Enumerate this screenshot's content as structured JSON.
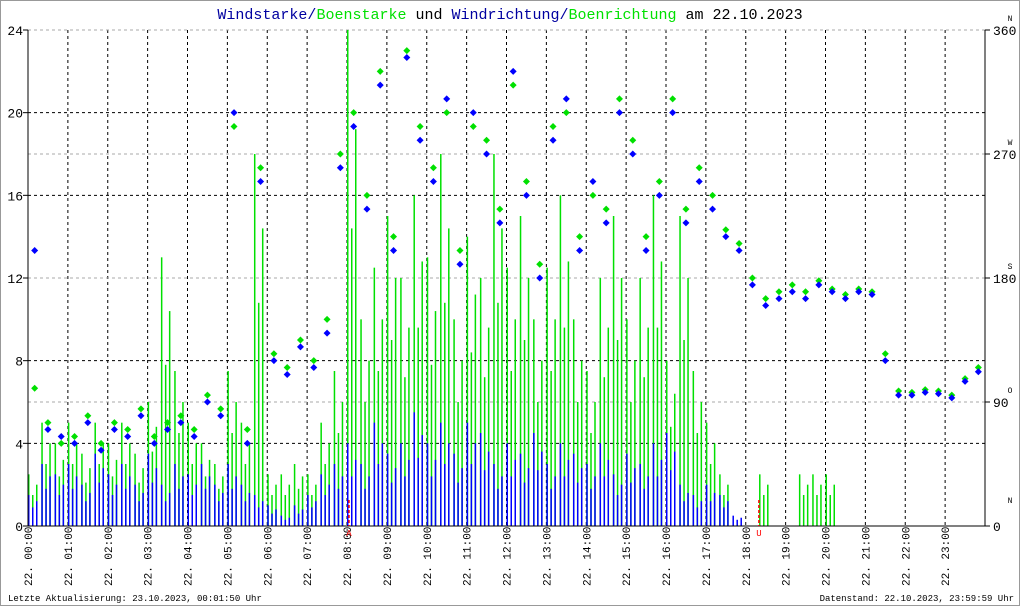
{
  "chart_data": {
    "type": "scatter",
    "title_parts": [
      {
        "text": "Windstarke",
        "color": "#0000a0"
      },
      {
        "text": "/",
        "color": "#0000a0"
      },
      {
        "text": "Boenstarke",
        "color": "#00e000"
      },
      {
        "text": " und ",
        "color": "#000000"
      },
      {
        "text": "Windrichtung",
        "color": "#0000a0"
      },
      {
        "text": "/",
        "color": "#0000a0"
      },
      {
        "text": "Boenrichtung",
        "color": "#00e000"
      },
      {
        "text": " am 22.10.2023",
        "color": "#000000"
      }
    ],
    "left_axis": {
      "ylim": [
        0,
        24
      ],
      "ticks": [
        "0",
        "4",
        "8",
        "12",
        "16",
        "20",
        "24"
      ]
    },
    "right_axis": {
      "ylim": [
        0,
        360
      ],
      "ticks": [
        "0",
        "90",
        "180",
        "270",
        "360"
      ],
      "compass": [
        "N",
        "O",
        "S",
        "W",
        "N"
      ]
    },
    "x_tick_labels": [
      "22. 00:00",
      "22. 01:00",
      "22. 02:00",
      "22. 03:00",
      "22. 04:00",
      "22. 05:00",
      "22. 06:00",
      "22. 07:00",
      "22. 08:00",
      "22. 09:00",
      "22. 10:00",
      "22. 11:00",
      "22. 12:00",
      "22. 13:00",
      "22. 14:00",
      "22. 15:00",
      "22. 16:00",
      "22. 17:00",
      "22. 18:00",
      "22. 19:00",
      "22. 20:00",
      "22. 21:00",
      "22. 22:00",
      "22. 23:00"
    ],
    "x_range_hours": [
      0,
      24
    ],
    "sample_interval_minutes": 20,
    "grid": true,
    "markers": [
      {
        "label": "A",
        "hour": 8.05,
        "color": "#ff0000"
      },
      {
        "label": "U",
        "hour": 18.33,
        "color": "#ff0000"
      }
    ],
    "series": [
      {
        "name": "Boenstarke",
        "kind": "bar",
        "axis": "left",
        "color": "#00e000",
        "values": [
          2.5,
          5,
          4,
          5,
          3.5,
          5,
          4,
          5,
          3.5,
          6,
          13,
          7.5,
          5,
          4,
          3,
          7.5,
          5,
          18,
          2.5,
          2.5,
          3,
          2.5,
          5,
          7.5,
          24,
          10,
          12.5,
          15,
          12,
          16,
          13,
          18,
          10,
          14,
          12,
          18,
          12.5,
          15,
          10,
          12.5,
          16,
          10,
          7.5,
          12,
          15,
          10,
          12,
          16,
          8,
          15,
          7.5,
          5,
          2.5,
          0,
          0,
          2.5,
          0,
          0,
          2.5,
          2.5,
          2.5,
          0,
          0,
          0,
          0,
          0,
          0,
          0,
          0,
          0,
          0,
          0
        ]
      },
      {
        "name": "Windstarke",
        "kind": "bar",
        "axis": "left",
        "color": "#0000ff",
        "values": [
          1.5,
          3,
          2.5,
          3,
          2,
          3.5,
          2.5,
          3,
          2,
          3.5,
          2,
          3,
          2.5,
          3,
          2,
          3,
          2,
          1.5,
          1,
          0.5,
          1,
          1.5,
          2.5,
          3,
          4,
          3,
          5,
          3.5,
          4,
          5.5,
          4,
          5,
          3.5,
          5,
          4.5,
          3,
          4,
          3.5,
          4.5,
          3,
          4,
          3.5,
          3,
          4,
          2.5,
          3.5,
          3,
          4,
          4.5,
          2,
          1.5,
          2,
          1.5,
          0.5,
          0,
          0,
          0,
          0,
          0,
          0,
          0,
          0,
          0,
          0,
          0,
          0,
          0,
          0,
          0,
          0,
          0,
          0
        ]
      },
      {
        "name": "Boenrichtung",
        "kind": "scatter",
        "axis": "right",
        "color": "#00e000",
        "values": [
          100,
          75,
          60,
          65,
          80,
          60,
          75,
          70,
          85,
          65,
          75,
          80,
          70,
          95,
          85,
          290,
          70,
          260,
          125,
          115,
          135,
          120,
          150,
          270,
          300,
          240,
          330,
          210,
          345,
          290,
          260,
          300,
          200,
          290,
          280,
          230,
          320,
          250,
          190,
          290,
          300,
          210,
          240,
          230,
          310,
          280,
          210,
          250,
          310,
          230,
          260,
          240,
          215,
          205,
          180,
          165,
          170,
          175,
          170,
          178,
          172,
          168,
          172,
          170,
          125,
          98,
          97,
          99,
          98,
          95,
          107,
          115
        ]
      },
      {
        "name": "Windrichtung",
        "kind": "scatter",
        "axis": "right",
        "color": "#0000ff",
        "values": [
          200,
          70,
          65,
          60,
          75,
          55,
          70,
          65,
          80,
          60,
          70,
          75,
          65,
          90,
          80,
          300,
          60,
          250,
          120,
          110,
          130,
          115,
          140,
          260,
          290,
          230,
          320,
          200,
          340,
          280,
          250,
          310,
          190,
          300,
          270,
          220,
          330,
          240,
          180,
          280,
          310,
          200,
          250,
          220,
          300,
          270,
          200,
          240,
          300,
          220,
          250,
          230,
          210,
          200,
          175,
          160,
          165,
          170,
          165,
          175,
          170,
          165,
          170,
          168,
          120,
          95,
          95,
          97,
          96,
          93,
          105,
          112
        ]
      }
    ]
  },
  "footer": {
    "left": "Letzte Aktualisierung: 23.10.2023, 00:01:50 Uhr",
    "right": "Datenstand: 22.10.2023, 23:59:59 Uhr"
  }
}
